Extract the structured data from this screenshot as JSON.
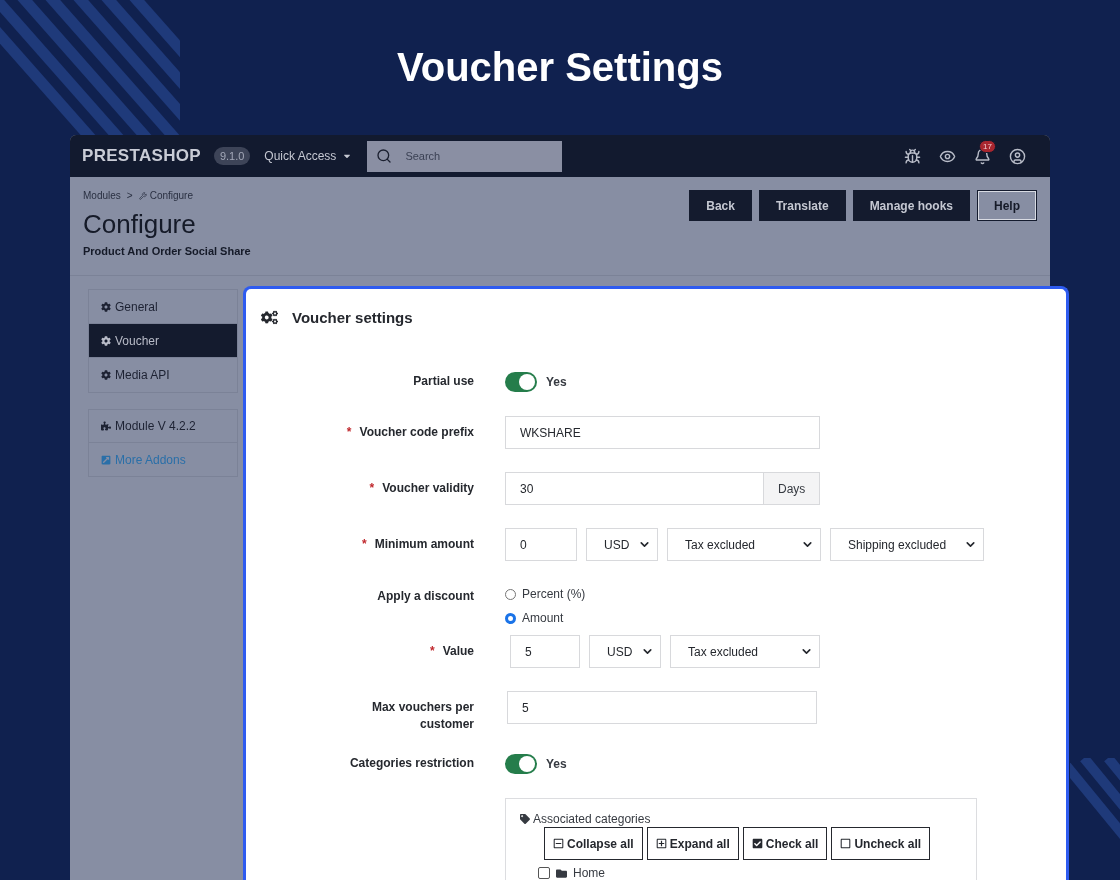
{
  "heading": "Voucher Settings",
  "topbar": {
    "logo": "PRESTASHOP",
    "version": "9.1.0",
    "quick_access": "Quick Access",
    "search": {
      "placeholder": "Search"
    },
    "notifications": "17"
  },
  "header": {
    "breadcrumb": [
      {
        "label": "Modules"
      },
      {
        "label": "Configure"
      }
    ],
    "separator": ">",
    "title": "Configure",
    "subtitle": "Product And Order Social Share",
    "buttons": [
      {
        "label": "Back",
        "kind": "dark"
      },
      {
        "label": "Translate",
        "kind": "dark"
      },
      {
        "label": "Manage hooks",
        "kind": "dark"
      },
      {
        "label": "Help",
        "kind": "outline"
      }
    ]
  },
  "sidebar": {
    "tabs": [
      {
        "label": "General",
        "selected": false
      },
      {
        "label": "Voucher",
        "selected": true
      },
      {
        "label": "Media API",
        "selected": false
      }
    ],
    "links": [
      {
        "label": "Module V 4.2.2",
        "kind": "info"
      },
      {
        "label": "More Addons",
        "kind": "link"
      }
    ]
  },
  "panel": {
    "title": "Voucher settings",
    "fields": [
      {
        "kind": "switch",
        "label": "Partial use",
        "on": true,
        "text": "Yes"
      },
      {
        "kind": "text",
        "label": "Voucher code prefix",
        "mark": "*",
        "value": "WKSHARE"
      },
      {
        "kind": "addon",
        "label": "Voucher validity",
        "mark": "*",
        "value": "30",
        "addon": "Days"
      },
      {
        "kind": "inputs",
        "label": "Minimum amount",
        "mark": "*",
        "value": "0",
        "selects": [
          "USD",
          "Tax excluded",
          "Shipping excluded"
        ]
      },
      {
        "kind": "radio",
        "label": "Apply a discount",
        "options": [
          {
            "label": "Percent (%)",
            "selected": false
          },
          {
            "label": "Amount",
            "selected": true
          }
        ]
      },
      {
        "kind": "inputs",
        "label": "Value",
        "mark": "*",
        "value": "5",
        "selects": [
          "USD",
          "Tax excluded"
        ]
      },
      {
        "kind": "short",
        "label": "Max vouchers per customer",
        "value": "5"
      },
      {
        "kind": "switch",
        "label": "Categories restriction",
        "on": true,
        "text": "Yes"
      }
    ],
    "categories": {
      "title": "Associated categories",
      "buttons": [
        {
          "label": "Collapse all",
          "kind": "collapse"
        },
        {
          "label": "Expand all",
          "kind": "expand"
        },
        {
          "label": "Check all",
          "kind": "check"
        },
        {
          "label": "Uncheck all",
          "kind": "uncheck"
        }
      ],
      "tree": [
        {
          "label": "Home",
          "checked": false
        }
      ]
    }
  }
}
